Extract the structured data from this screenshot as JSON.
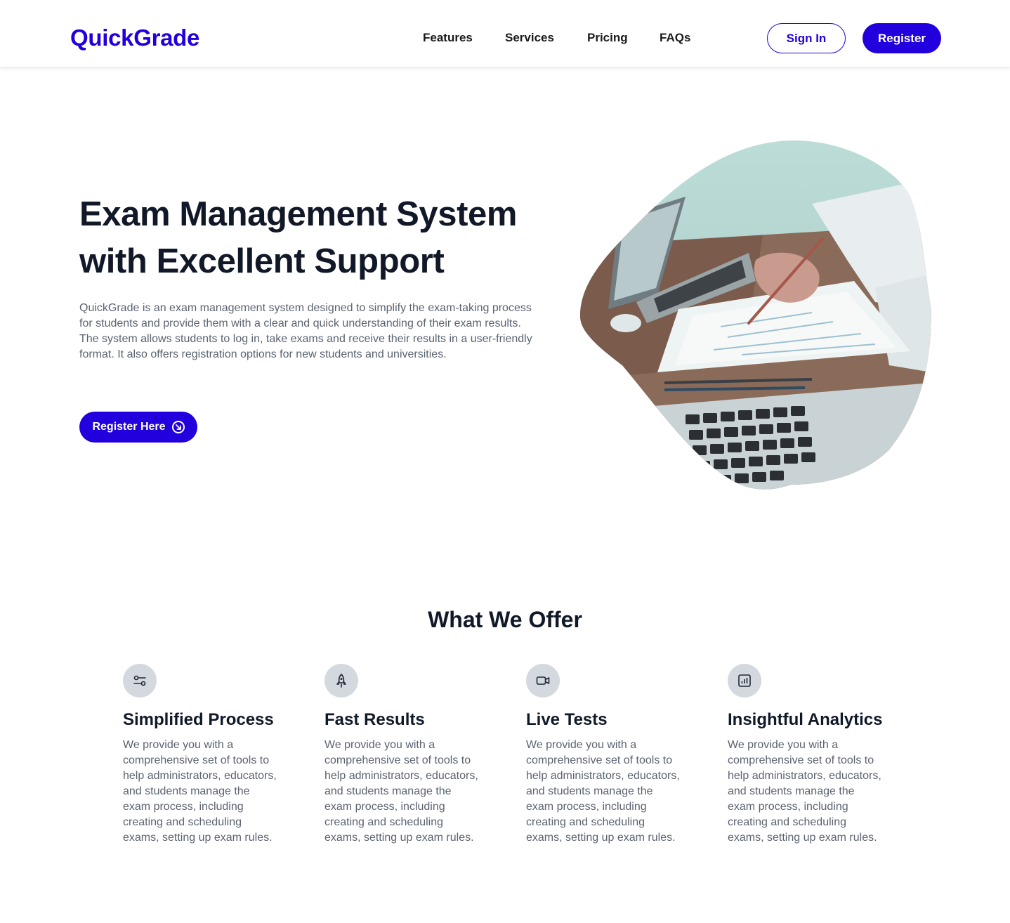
{
  "brand": {
    "name": "QuickGrade",
    "accent_color": "#2200dd"
  },
  "nav": {
    "items": [
      "Features",
      "Services",
      "Pricing",
      "FAQs"
    ]
  },
  "header": {
    "sign_in_label": "Sign In",
    "register_label": "Register"
  },
  "hero": {
    "title_line1": "Exam Management System",
    "title_line2": "with Excellent Support",
    "description": "QuickGrade is an exam management system designed to simplify the exam-taking process for students and provide them with a clear and quick understanding of their exam results. The system allows students to log in, take exams and receive their results in a user-friendly format. It also offers registration options for new students and universities.",
    "cta_label": "Register Here",
    "cta_icon": "arrow-circle-icon",
    "image_icon": "laptop-desk-photo"
  },
  "offer": {
    "title": "What We Offer",
    "cards": [
      {
        "icon": "toggle-settings-icon",
        "title": "Simplified Process",
        "text": "We provide you with a comprehensive set of tools to help administrators, educators, and students manage the exam process, including creating and scheduling exams, setting up exam rules."
      },
      {
        "icon": "rocket-icon",
        "title": "Fast Results",
        "text": "We provide you with a comprehensive set of tools to help administrators, educators, and students manage the exam process, including creating and scheduling exams, setting up exam rules."
      },
      {
        "icon": "video-camera-icon",
        "title": "Live Tests",
        "text": "We provide you with a comprehensive set of tools to help administrators, educators, and students manage the exam process, including creating and scheduling exams, setting up exam rules."
      },
      {
        "icon": "analytics-chart-icon",
        "title": "Insightful Analytics",
        "text": "We provide you with a comprehensive set of tools to help administrators, educators, and students manage the exam process, including creating and scheduling exams, setting up exam rules."
      }
    ]
  }
}
